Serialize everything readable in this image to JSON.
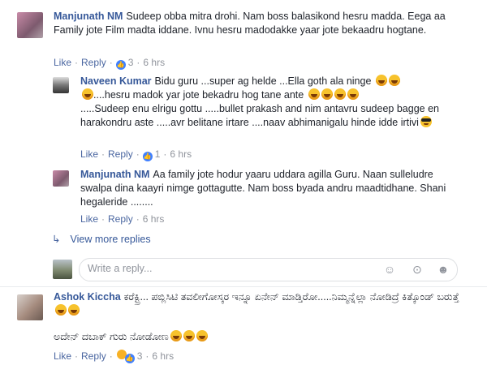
{
  "comments": [
    {
      "author": "Manjunath NM",
      "text": "Sudeep obba mitra drohi. Nam boss balasikond hesru madda. Eega aa Family jote Film madta iddane. Ivnu hesru madodakke yaar jote bekaadru hogtane.",
      "like_label": "Like",
      "reply_label": "Reply",
      "reactions": "3",
      "time": "6 hrs"
    },
    {
      "author": "Naveen Kumar",
      "text_parts": [
        "Bidu guru ...super ag helde ...Ella goth ala ninge",
        "....hesru madok yar jote bekadru hog tane ante",
        ".....Sudeep enu elrigu gottu .....bullet prakash and nim antavru sudeep bagge en harakondru aste .....avr belitane irtare ....naav abhimanigalu hinde idde irtivi"
      ],
      "like_label": "Like",
      "reply_label": "Reply",
      "reactions": "1",
      "time": "6 hrs"
    },
    {
      "author": "Manjunath NM",
      "text": "Aa family jote hodur yaaru uddara agilla Guru. Naan sulleludre swalpa dina kaayri nimge gottagutte. Nam boss byada andru maadtidhane. Shani hegaleride ........",
      "like_label": "Like",
      "reply_label": "Reply",
      "time": "6 hrs"
    },
    {
      "author": "Ashok Kiccha",
      "text": "ಕರೆಕ್ಟ್ರಿ... ಪಬ್ಲಿಸಿಟಿ ತವಲೀಗೋಸ್ಕರ ಇನ್ನೂ ಏನೇನ್ ಮಾಡ್ತಿರೋ.....ನಿಮ್ಮನ್ನೆಲ್ಲಾ ನೋಡಿದ್ರೆ ಕಿತ್ಕೊಂಡ್ ಬರುತ್ತೆ",
      "text2": "ಅದೇನ್ ದಬಾಕ್ ಗುರು ನೋಡೋಣ",
      "like_label": "Like",
      "reply_label": "Reply",
      "reactions": "3",
      "time": "6 hrs"
    }
  ],
  "view_more": "View more replies",
  "reply_box": {
    "placeholder": "Write a reply..."
  },
  "icons": [
    "emoji-icon",
    "camera-icon",
    "sticker-icon"
  ],
  "colors": {
    "name": "#365899",
    "link": "#4b67a1",
    "meta": "#90949c",
    "like": "#4080ff",
    "emoji": "#f7c22c"
  }
}
